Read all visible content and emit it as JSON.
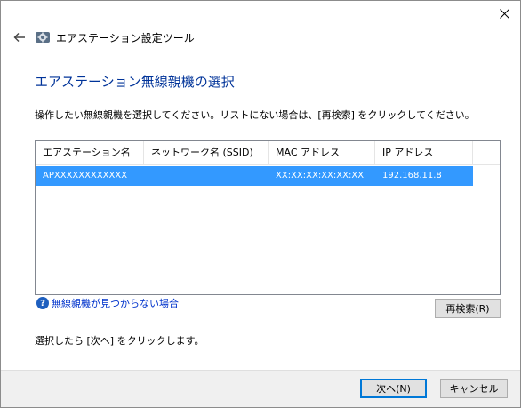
{
  "window": {
    "title": "エアステーション設定ツール"
  },
  "page": {
    "heading": "エアステーション無線親機の選択",
    "instruction": "操作したい無線親機を選択してください。リストにない場合は、[再検索] をクリックしてください。",
    "footer_note": "選択したら [次へ] をクリックします。"
  },
  "list": {
    "columns": [
      "エアステーション名",
      "ネットワーク名 (SSID)",
      "MAC アドレス",
      "IP アドレス"
    ],
    "rows": [
      [
        "APXXXXXXXXXXXX",
        "",
        "XX:XX:XX:XX:XX:XX",
        "192.168.11.8"
      ]
    ],
    "selected_row": 0
  },
  "help": {
    "link": "無線親機が見つからない場合"
  },
  "buttons": {
    "rescan": "再検索(R)",
    "next": "次へ(N)",
    "cancel": "キャンセル"
  },
  "icons": {
    "back": "back-arrow-icon",
    "app": "settings-gear-icon",
    "close": "close-icon",
    "help": "help-question-icon"
  },
  "colors": {
    "heading": "#003399",
    "selection": "#3399ff",
    "link": "#0033cc",
    "default_button_border": "#0078d7"
  }
}
